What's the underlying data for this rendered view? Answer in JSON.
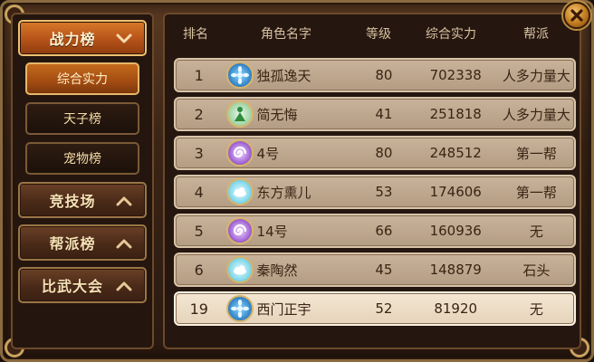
{
  "sidebar": {
    "categories": [
      {
        "label": "战力榜",
        "active": true
      },
      {
        "label": "竞技场",
        "active": false
      },
      {
        "label": "帮派榜",
        "active": false
      },
      {
        "label": "比武大会",
        "active": false
      }
    ],
    "subitems": [
      {
        "label": "综合实力",
        "active": true
      },
      {
        "label": "天子榜",
        "active": false
      },
      {
        "label": "宠物榜",
        "active": false
      }
    ]
  },
  "table": {
    "headers": {
      "rank": "排名",
      "name": "角色名字",
      "level": "等级",
      "power": "综合实力",
      "guild": "帮派"
    },
    "rows": [
      {
        "rank": "1",
        "name": "独孤逸天",
        "level": "80",
        "power": "702338",
        "guild": "人多力量大",
        "avatar": "blue-flower-icon"
      },
      {
        "rank": "2",
        "name": "简无悔",
        "level": "41",
        "power": "251818",
        "guild": "人多力量大",
        "avatar": "green-figure-icon"
      },
      {
        "rank": "3",
        "name": "4号",
        "level": "80",
        "power": "248512",
        "guild": "第一帮",
        "avatar": "purple-swirl-icon"
      },
      {
        "rank": "4",
        "name": "东方熏儿",
        "level": "53",
        "power": "174606",
        "guild": "第一帮",
        "avatar": "cyan-cloud-icon"
      },
      {
        "rank": "5",
        "name": "14号",
        "level": "66",
        "power": "160936",
        "guild": "无",
        "avatar": "purple-swirl-icon"
      },
      {
        "rank": "6",
        "name": "秦陶然",
        "level": "45",
        "power": "148879",
        "guild": "石头",
        "avatar": "cyan-cloud-icon"
      }
    ],
    "self_row": {
      "rank": "19",
      "name": "西门正宇",
      "level": "52",
      "power": "81920",
      "guild": "无",
      "avatar": "blue-flower-icon"
    }
  },
  "colors": {
    "accent_orange": "#c46a1c",
    "row_bg": "#c9b39a",
    "self_row_bg": "#f3e6d2",
    "gold_border": "#d9b56a"
  }
}
